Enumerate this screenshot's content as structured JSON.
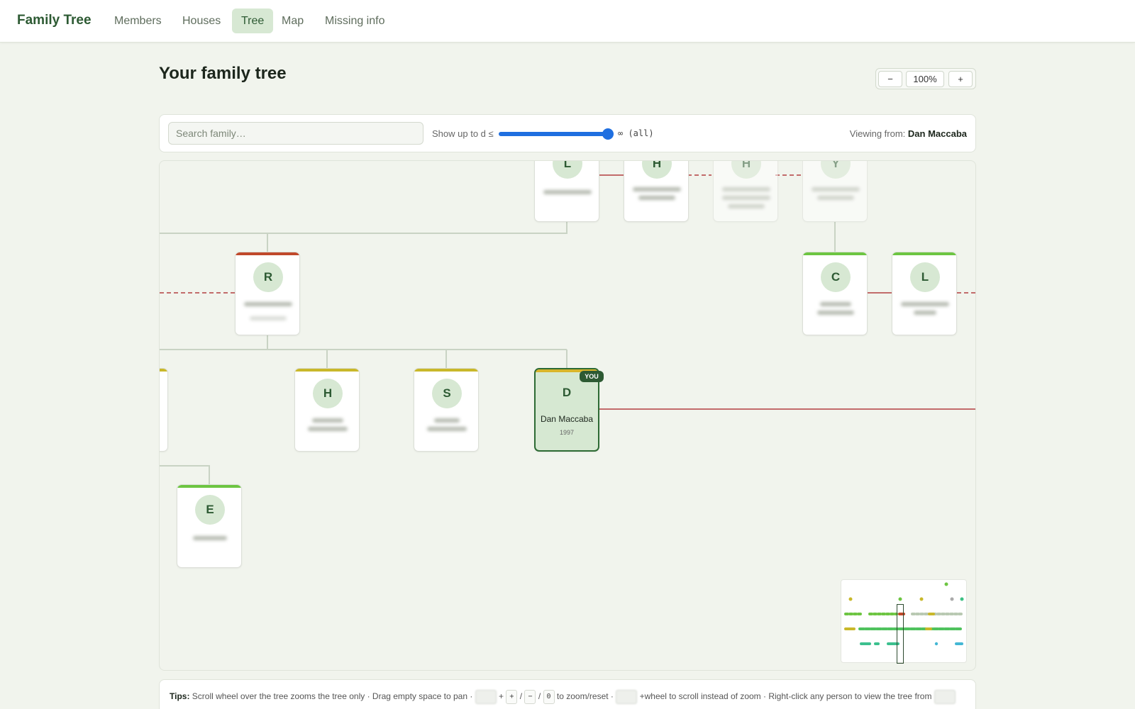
{
  "nav": {
    "brand": "Family Tree",
    "tabs": [
      {
        "label": "Members",
        "active": false
      },
      {
        "label": "Houses",
        "active": false
      },
      {
        "label": "Tree",
        "active": true
      },
      {
        "label": "Map",
        "active": false
      },
      {
        "label": "Missing info",
        "active": false
      }
    ]
  },
  "page": {
    "title": "Your family tree"
  },
  "zoom": {
    "minus": "−",
    "level": "100%",
    "plus": "+"
  },
  "controls": {
    "search_placeholder": "Search family…",
    "depth_label": "Show up to d ≤",
    "depth_value": "∞ (all)",
    "depth_fraction": 1.0,
    "viewing_label": "Viewing from:",
    "viewing_name": "Dan Maccaba"
  },
  "tree": {
    "people": [
      {
        "initial": "L",
        "color": "#2d5a33",
        "faded": false
      },
      {
        "initial": "H",
        "color": "#2d5a33",
        "faded": false
      },
      {
        "initial": "H",
        "color": "#2d5a33",
        "faded": true
      },
      {
        "initial": "Y",
        "color": "#2d5a33",
        "faded": true
      },
      {
        "initial": "R",
        "color": "#2d5a33",
        "faded": false
      },
      {
        "initial": "C",
        "color": "#2d5a33",
        "faded": false
      },
      {
        "initial": "L",
        "color": "#2d5a33",
        "faded": false
      },
      {
        "initial": "H",
        "color": "#2d5a33",
        "faded": false
      },
      {
        "initial": "S",
        "color": "#2d5a33",
        "faded": false
      },
      {
        "initial": "E",
        "color": "#2d5a33",
        "faded": false
      }
    ],
    "you": {
      "initial": "D",
      "name": "Dan Maccaba",
      "year": "1997",
      "badge": "YOU"
    },
    "bar_colors": {
      "red": "#c0492b",
      "green": "#6dc542",
      "yellow": "#c9b82a",
      "you": "#d9b52a"
    },
    "line_colors": {
      "parent": "#c9d3c4",
      "partner": "#c26b6b"
    }
  },
  "tips": {
    "label": "Tips:",
    "t1": "Scroll wheel over the tree zooms the tree only · Drag empty space to pan ·",
    "plus_sep": "+",
    "key_plus": "+",
    "slash1": "/",
    "key_minus": "−",
    "slash2": "/",
    "key_zero": "0",
    "t2": "to zoom/reset ·",
    "t3": "+wheel to scroll instead of zoom · Right-click any person to view the tree from"
  }
}
